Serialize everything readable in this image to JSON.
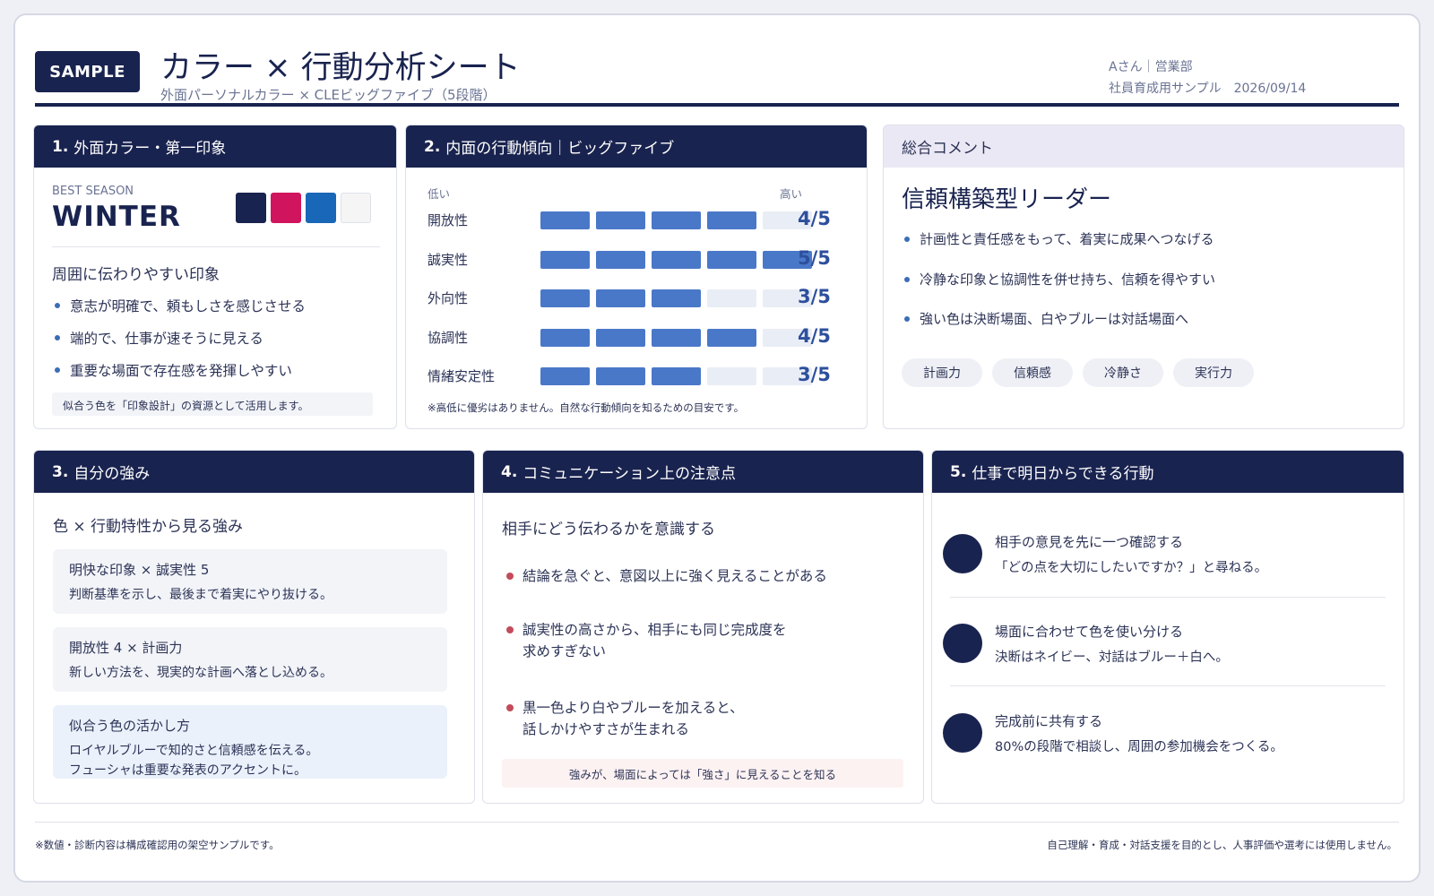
{
  "header": {
    "badge": "SAMPLE",
    "title": "カラー × 行動分析シート",
    "subtitle": "外面パーソナルカラー × CLEビッグファイブ（5段階）",
    "person": "Aさん｜営業部",
    "purpose": "社員育成用サンプル",
    "date": "2026/09/14"
  },
  "section1": {
    "heading_num": "1.",
    "heading": "外面カラー・第一印象",
    "season_label": "BEST SEASON",
    "season": "WINTER",
    "swatches": [
      "#19234f",
      "#d0145d",
      "#1967b8",
      "#f5f5f5"
    ],
    "impression_title": "周囲に伝わりやすい印象",
    "bullets": [
      "意志が明確で、頼もしさを感じさせる",
      "端的で、仕事が速そうに見える",
      "重要な場面で存在感を発揮しやすい"
    ],
    "note": "似合う色を「印象設計」の資源として活用します。"
  },
  "section2": {
    "heading_num": "2.",
    "heading": "内面の行動傾向｜ビッグファイブ",
    "low_label": "低い",
    "high_label": "高い",
    "max": 5,
    "traits": [
      {
        "name": "開放性",
        "score": 4,
        "score_label": "4/5"
      },
      {
        "name": "誠実性",
        "score": 5,
        "score_label": "5/5"
      },
      {
        "name": "外向性",
        "score": 3,
        "score_label": "3/5"
      },
      {
        "name": "協調性",
        "score": 4,
        "score_label": "4/5"
      },
      {
        "name": "情緒安定性",
        "score": 3,
        "score_label": "3/5"
      }
    ],
    "note": "※高低に優劣はありません。自然な行動傾向を知るための目安です。",
    "bar_color": "#4a78c8",
    "bar_empty_color": "#e9edf5"
  },
  "summary": {
    "heading": "総合コメント",
    "type": "信頼構築型リーダー",
    "bullets": [
      "計画性と責任感をもって、着実に成果へつなげる",
      "冷静な印象と協調性を併せ持ち、信頼を得やすい",
      "強い色は決断場面、白やブルーは対話場面へ"
    ],
    "tags": [
      "計画力",
      "信頼感",
      "冷静さ",
      "実行力"
    ]
  },
  "section3": {
    "heading_num": "3.",
    "heading": "自分の強み",
    "subtitle": "色 × 行動特性から見る強み",
    "items": [
      {
        "title": "明快な印象 × 誠実性 5",
        "desc": "判断基準を示し、最後まで着実にやり抜ける。"
      },
      {
        "title": "開放性 4 × 計画力",
        "desc": "新しい方法を、現実的な計画へ落とし込める。"
      },
      {
        "title": "似合う色の活かし方",
        "desc": "ロイヤルブルーで知的さと信頼感を伝える。\nフューシャは重要な発表のアクセントに。"
      }
    ]
  },
  "section4": {
    "heading_num": "4.",
    "heading": "コミュニケーション上の注意点",
    "subtitle": "相手にどう伝わるかを意識する",
    "bullets": [
      "結論を急ぐと、意図以上に強く見えることがある",
      "誠実性の高さから、相手にも同じ完成度を\n求めすぎない",
      "黒一色より白やブルーを加えると、\n話しかけやすさが生まれる"
    ],
    "note": "強みが、場面によっては「強さ」に見えることを知る"
  },
  "section5": {
    "heading_num": "5.",
    "heading": "仕事で明日からできる行動",
    "steps": [
      {
        "num": "1",
        "title": "相手の意見を先に一つ確認する",
        "desc": "「どの点を大切にしたいですか？」と尋ねる。"
      },
      {
        "num": "2",
        "title": "場面に合わせて色を使い分ける",
        "desc": "決断はネイビー、対話はブルー＋白へ。"
      },
      {
        "num": "3",
        "title": "完成前に共有する",
        "desc": "80%の段階で相談し、周囲の参加機会をつくる。"
      }
    ]
  },
  "footer": {
    "left": "※数値・診断内容は構成確認用の架空サンプルです。",
    "right": "自己理解・育成・対話支援を目的とし、人事評価や選考には使用しません。"
  }
}
